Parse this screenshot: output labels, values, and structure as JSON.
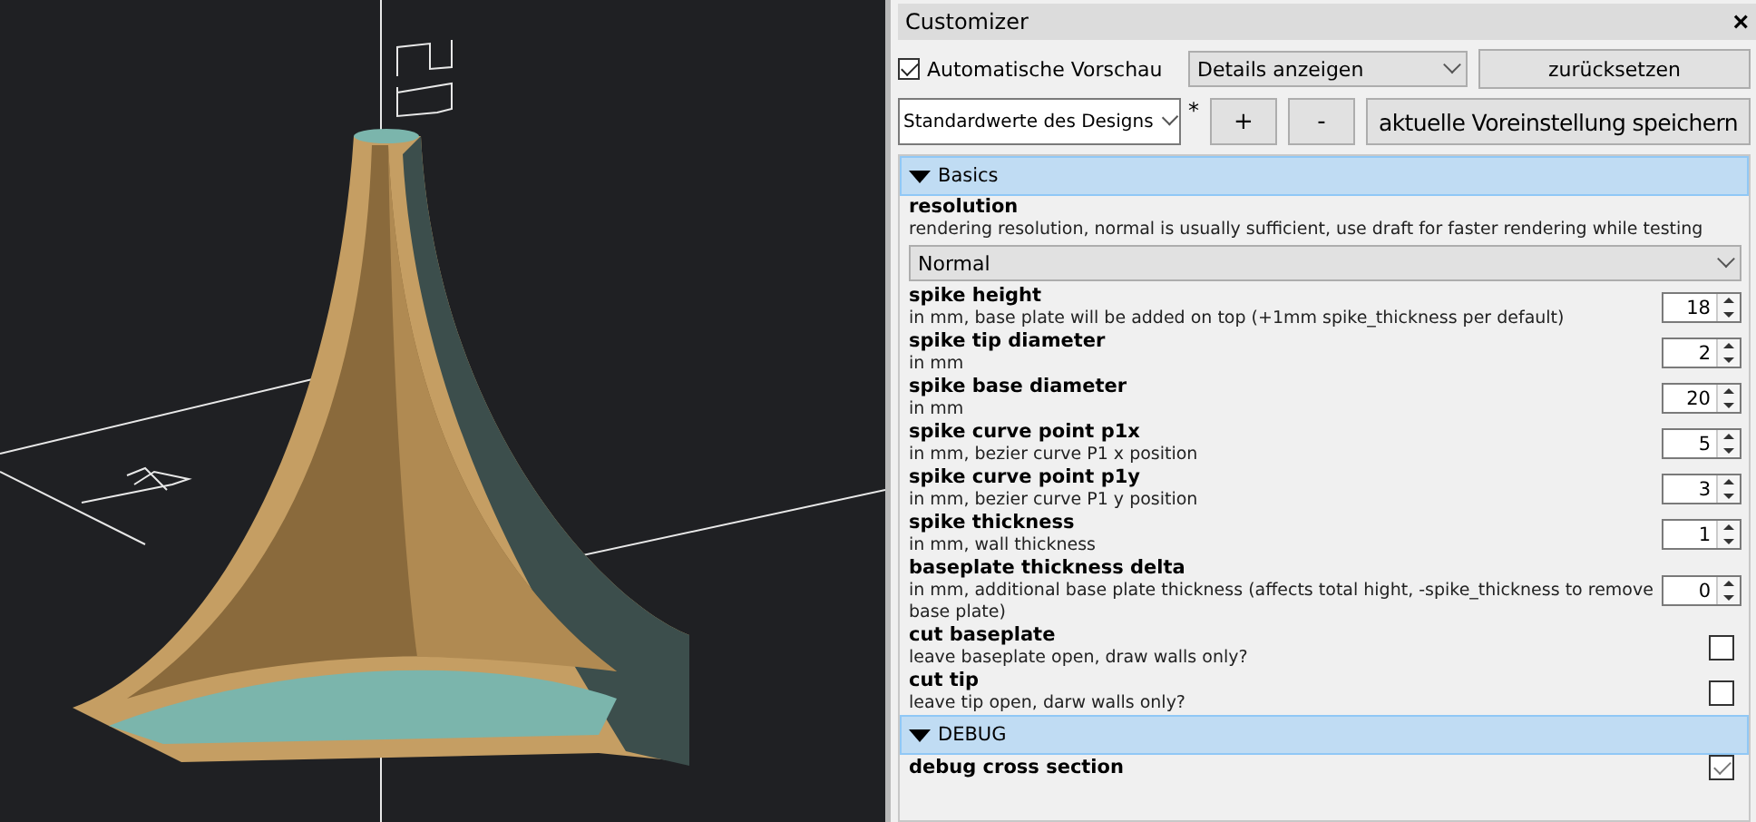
{
  "viewport": {
    "kind": "scene"
  },
  "customizer": {
    "title": "Customizer",
    "close": "×",
    "auto_preview": {
      "label": "Automatische Vorschau",
      "checked": true
    },
    "details": "Details anzeigen",
    "reset": "zurücksetzen",
    "preset": "Standardwerte des Designs",
    "modified": "*",
    "add": "+",
    "remove": "-",
    "save": "aktuelle Voreinstellung speichern",
    "sections": [
      {
        "title": "Basics",
        "expanded": true,
        "params": [
          {
            "kind": "dropdown",
            "name": "resolution",
            "description": "rendering resolution, normal is usually sufficient, use draft for faster rendering while testing",
            "value": "Normal"
          },
          {
            "kind": "spinbox",
            "name": "spike height",
            "description": "in mm, base plate will be added on top (+1mm spike_thickness per default)",
            "value": "18"
          },
          {
            "kind": "spinbox",
            "name": "spike tip diameter",
            "description": "in mm",
            "value": "2"
          },
          {
            "kind": "spinbox",
            "name": "spike base diameter",
            "description": "in mm",
            "value": "20"
          },
          {
            "kind": "spinbox",
            "name": "spike curve point p1x",
            "description": "in mm, bezier curve P1 x position",
            "value": "5"
          },
          {
            "kind": "spinbox",
            "name": "spike curve point p1y",
            "description": "in mm, bezier curve P1 y position",
            "value": "3"
          },
          {
            "kind": "spinbox",
            "name": "spike thickness",
            "description": "in mm, wall thickness",
            "value": "1"
          },
          {
            "kind": "spinbox",
            "name": "baseplate thickness delta",
            "description": "in mm, additional base plate thickness (affects total hight, -spike_thickness to remove base plate)",
            "value": "0"
          },
          {
            "kind": "checkbox",
            "name": "cut baseplate",
            "description": "leave baseplate open, draw walls only?",
            "checked": false
          },
          {
            "kind": "checkbox",
            "name": "cut tip",
            "description": "leave tip open, darw walls only?",
            "checked": false
          }
        ]
      },
      {
        "title": "DEBUG",
        "expanded": true,
        "params": [
          {
            "kind": "checkbox",
            "name": "debug cross section",
            "checked": true
          }
        ]
      }
    ]
  }
}
